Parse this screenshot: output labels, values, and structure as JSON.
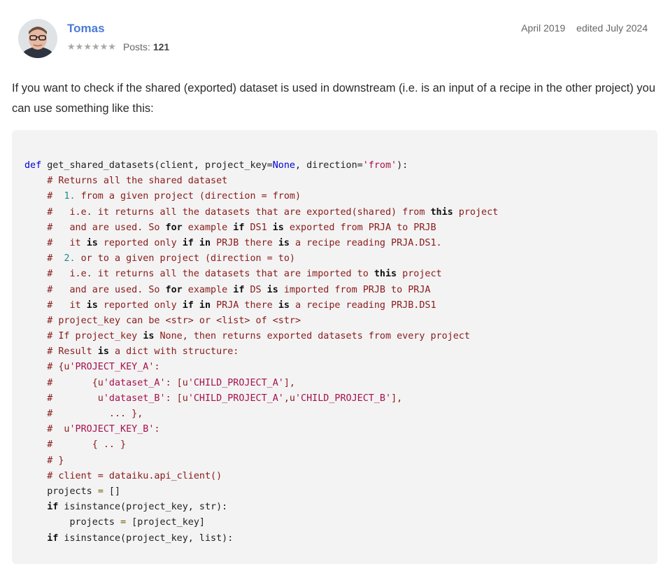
{
  "post": {
    "author": "Tomas",
    "rank_stars": 6,
    "posts_label": "Posts:",
    "posts_count": "121",
    "date": "April 2019",
    "edited": "edited July 2024",
    "message": "If you want to check if the shared (exported) dataset is used in downstream (i.e. is an input of a recipe in the other project) you can use something like this:"
  },
  "colors": {
    "username": "#4c7ad8",
    "code_bg": "#f3f3f3",
    "keyword": "#0000d6",
    "comment": "#8a1a1a",
    "string": "#a5114b",
    "number": "#1f8a8a"
  },
  "icons": {
    "star": "star-icon",
    "avatar": "user-avatar-photo"
  },
  "code": {
    "lines": [
      [
        {
          "t": "def",
          "c": "kw"
        },
        {
          "t": " get_shared_datasets(client, project_key="
        },
        {
          "t": "None",
          "c": "kw"
        },
        {
          "t": ", direction="
        },
        {
          "t": "'from'",
          "c": "st"
        },
        {
          "t": "):"
        }
      ],
      [
        {
          "t": "    # Returns all the shared dataset",
          "c": "cm"
        }
      ],
      [
        {
          "t": "    #  ",
          "c": "cm"
        },
        {
          "t": "1.",
          "c": "nu"
        },
        {
          "t": " from a given project (direction = from)",
          "c": "cm"
        }
      ],
      [
        {
          "t": "    #   i.e. it returns all the datasets that are exported(shared) from ",
          "c": "cm"
        },
        {
          "t": "this",
          "c": "kwb"
        },
        {
          "t": " project",
          "c": "cm"
        }
      ],
      [
        {
          "t": "    #   and are used. So ",
          "c": "cm"
        },
        {
          "t": "for",
          "c": "kwb"
        },
        {
          "t": " example ",
          "c": "cm"
        },
        {
          "t": "if",
          "c": "kwb"
        },
        {
          "t": " DS1 ",
          "c": "cm"
        },
        {
          "t": "is",
          "c": "kwb"
        },
        {
          "t": " exported from PRJA to PRJB",
          "c": "cm"
        }
      ],
      [
        {
          "t": "    #   it ",
          "c": "cm"
        },
        {
          "t": "is",
          "c": "kwb"
        },
        {
          "t": " reported only ",
          "c": "cm"
        },
        {
          "t": "if in",
          "c": "kwb"
        },
        {
          "t": " PRJB there ",
          "c": "cm"
        },
        {
          "t": "is",
          "c": "kwb"
        },
        {
          "t": " a recipe reading PRJA.DS1.",
          "c": "cm"
        }
      ],
      [
        {
          "t": "    #  ",
          "c": "cm"
        },
        {
          "t": "2.",
          "c": "nu"
        },
        {
          "t": " or to a given project (direction = to)",
          "c": "cm"
        }
      ],
      [
        {
          "t": "    #   i.e. it returns all the datasets that are imported to ",
          "c": "cm"
        },
        {
          "t": "this",
          "c": "kwb"
        },
        {
          "t": " project",
          "c": "cm"
        }
      ],
      [
        {
          "t": "    #   and are used. So ",
          "c": "cm"
        },
        {
          "t": "for",
          "c": "kwb"
        },
        {
          "t": " example ",
          "c": "cm"
        },
        {
          "t": "if",
          "c": "kwb"
        },
        {
          "t": " DS ",
          "c": "cm"
        },
        {
          "t": "is",
          "c": "kwb"
        },
        {
          "t": " imported from PRJB to PRJA",
          "c": "cm"
        }
      ],
      [
        {
          "t": "    #   it ",
          "c": "cm"
        },
        {
          "t": "is",
          "c": "kwb"
        },
        {
          "t": " reported only ",
          "c": "cm"
        },
        {
          "t": "if in",
          "c": "kwb"
        },
        {
          "t": " PRJA there ",
          "c": "cm"
        },
        {
          "t": "is",
          "c": "kwb"
        },
        {
          "t": " a recipe reading PRJB.DS1",
          "c": "cm"
        }
      ],
      [
        {
          "t": "    # project_key can be <str> or <list> of <str>",
          "c": "cm"
        }
      ],
      [
        {
          "t": "    # If project_key ",
          "c": "cm"
        },
        {
          "t": "is",
          "c": "kwb"
        },
        {
          "t": " None, then returns exported datasets from every project",
          "c": "cm"
        }
      ],
      [
        {
          "t": "    # Result ",
          "c": "cm"
        },
        {
          "t": "is",
          "c": "kwb"
        },
        {
          "t": " a dict with structure:",
          "c": "cm"
        }
      ],
      [
        {
          "t": "    # {u",
          "c": "cm"
        },
        {
          "t": "'PROJECT_KEY_A'",
          "c": "st"
        },
        {
          "t": ":",
          "c": "cm"
        }
      ],
      [
        {
          "t": "    #       {u",
          "c": "cm"
        },
        {
          "t": "'dataset_A'",
          "c": "st"
        },
        {
          "t": ": [u",
          "c": "cm"
        },
        {
          "t": "'CHILD_PROJECT_A'",
          "c": "st"
        },
        {
          "t": "],",
          "c": "cm"
        }
      ],
      [
        {
          "t": "    #        u",
          "c": "cm"
        },
        {
          "t": "'dataset_B'",
          "c": "st"
        },
        {
          "t": ": [u",
          "c": "cm"
        },
        {
          "t": "'CHILD_PROJECT_A'",
          "c": "st"
        },
        {
          "t": ",u",
          "c": "cm"
        },
        {
          "t": "'CHILD_PROJECT_B'",
          "c": "st"
        },
        {
          "t": "],",
          "c": "cm"
        }
      ],
      [
        {
          "t": "    #          ... },",
          "c": "cm"
        }
      ],
      [
        {
          "t": "    #  u",
          "c": "cm"
        },
        {
          "t": "'PROJECT_KEY_B'",
          "c": "st"
        },
        {
          "t": ":",
          "c": "cm"
        }
      ],
      [
        {
          "t": "    #       { .. }",
          "c": "cm"
        }
      ],
      [
        {
          "t": "    # }",
          "c": "cm"
        }
      ],
      [
        {
          "t": "    # client = dataiku.api_client()",
          "c": "cm"
        }
      ],
      [
        {
          "t": "    projects "
        },
        {
          "t": "=",
          "c": "op"
        },
        {
          "t": " []"
        }
      ],
      [
        {
          "t": "    "
        },
        {
          "t": "if",
          "c": "kwb"
        },
        {
          "t": " isinstance(project_key, str):"
        }
      ],
      [
        {
          "t": "        projects "
        },
        {
          "t": "=",
          "c": "op"
        },
        {
          "t": " [project_key]"
        }
      ],
      [
        {
          "t": "    "
        },
        {
          "t": "if",
          "c": "kwb"
        },
        {
          "t": " isinstance(project_key, list):"
        }
      ]
    ]
  }
}
